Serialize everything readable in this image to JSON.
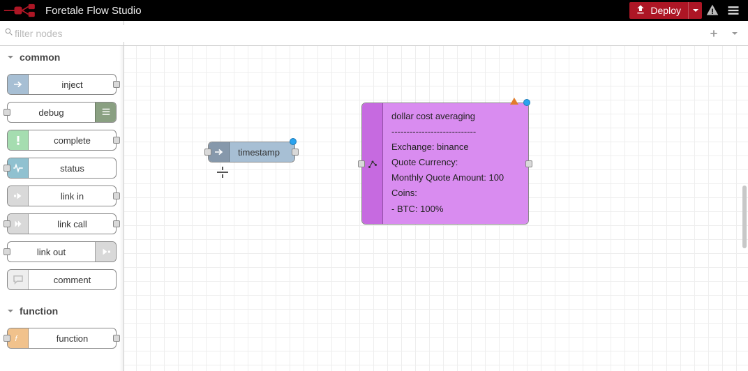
{
  "header": {
    "title": "Foretale Flow Studio",
    "deploy_label": "Deploy"
  },
  "palette": {
    "filter_placeholder": "filter nodes",
    "categories": [
      {
        "name": "common",
        "items": [
          {
            "id": "inject",
            "label": "inject",
            "color": "c-inject",
            "icon": "arrow-in",
            "ports": {
              "in": false,
              "out": true
            }
          },
          {
            "id": "debug",
            "label": "debug",
            "color": "c-debug",
            "icon": "bars",
            "icon_side": "right",
            "ports": {
              "in": true,
              "out": false
            }
          },
          {
            "id": "complete",
            "label": "complete",
            "color": "c-complete",
            "icon": "bang",
            "ports": {
              "in": false,
              "out": true
            }
          },
          {
            "id": "status",
            "label": "status",
            "color": "c-status",
            "icon": "pulse",
            "ports": {
              "in": true,
              "out": false
            }
          },
          {
            "id": "link-in",
            "label": "link in",
            "color": "c-link",
            "icon": "link-in",
            "ports": {
              "in": false,
              "out": true
            }
          },
          {
            "id": "link-call",
            "label": "link call",
            "color": "c-link",
            "icon": "link-call",
            "ports": {
              "in": true,
              "out": true
            }
          },
          {
            "id": "link-out",
            "label": "link out",
            "color": "c-link",
            "icon": "link-out",
            "icon_side": "right",
            "ports": {
              "in": true,
              "out": false
            }
          },
          {
            "id": "comment",
            "label": "comment",
            "color": "c-comment",
            "icon": "speech",
            "ports": {
              "in": false,
              "out": false
            }
          }
        ]
      },
      {
        "name": "function",
        "items": [
          {
            "id": "function",
            "label": "function",
            "color": "c-function",
            "icon": "fx",
            "ports": {
              "in": true,
              "out": true
            }
          }
        ]
      }
    ]
  },
  "canvas": {
    "nodes": {
      "timestamp": {
        "label": "timestamp",
        "has_status_dot": true
      },
      "dca": {
        "has_status_dot": true,
        "has_warning": true,
        "lines": [
          "dollar cost averaging",
          "----------------------------",
          "Exchange: binance",
          "Quote Currency:",
          "Monthly Quote Amount: 100",
          "Coins:",
          "- BTC: 100%"
        ]
      }
    }
  }
}
